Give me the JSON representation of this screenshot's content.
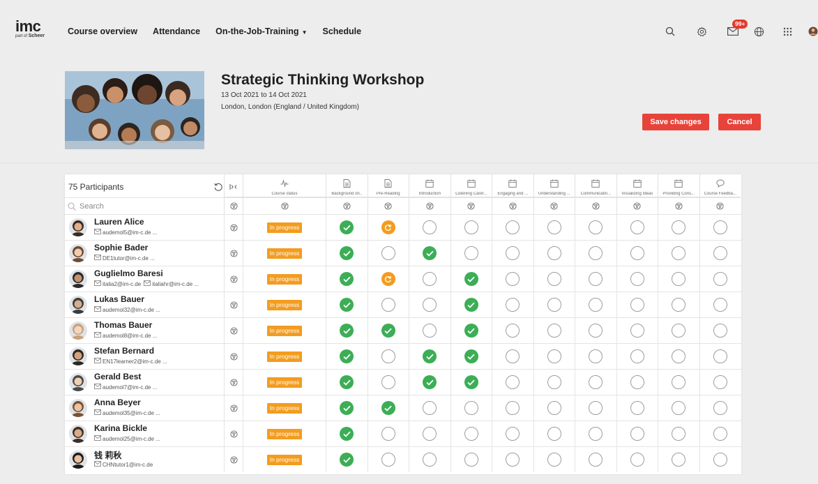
{
  "logo": {
    "text": "imc",
    "sub_prefix": "part of",
    "sub_brand": "Scheer"
  },
  "nav": {
    "items": [
      "Course overview",
      "Attendance",
      "On-the-Job-Training",
      "Schedule"
    ]
  },
  "topbar": {
    "icons": [
      "search-icon",
      "gear-icon",
      "mail-icon",
      "globe-icon",
      "apps-grid-icon",
      "user-avatar-icon"
    ],
    "notification_badge": "99+"
  },
  "course": {
    "title": "Strategic Thinking Workshop",
    "dates": "13 Oct 2021 to 14 Oct 2021",
    "location": "London, London (England / United Kingdom)"
  },
  "actions": {
    "save_label": "Save changes",
    "cancel_label": "Cancel"
  },
  "colors": {
    "accent": "#e8433a",
    "done": "#3cae56",
    "in_progress": "#f39c1f"
  },
  "grid": {
    "participant_count": "75 Participants",
    "search_placeholder": "Search",
    "status_column": {
      "label": "Course status",
      "icon": "activity-icon"
    },
    "columns": [
      {
        "label": "Background on..",
        "icon": "document-icon"
      },
      {
        "label": "Pre-Reading",
        "icon": "document-icon"
      },
      {
        "label": "Introduction",
        "icon": "calendar-icon"
      },
      {
        "label": "Listening Caref...",
        "icon": "calendar-icon"
      },
      {
        "label": "Engaging and ...",
        "icon": "calendar-icon"
      },
      {
        "label": "Understanding ...",
        "icon": "calendar-icon"
      },
      {
        "label": "Communicatin...",
        "icon": "calendar-icon"
      },
      {
        "label": "Visualizing Ideas",
        "icon": "calendar-icon"
      },
      {
        "label": "Providing Cons...",
        "icon": "calendar-icon"
      },
      {
        "label": "Course Feedba...",
        "icon": "chat-icon"
      }
    ],
    "participants": [
      {
        "name": "Lauren Alice",
        "email": "audemol5@im-c.de ...",
        "status": "In progress",
        "cells": [
          "done",
          "progress",
          "empty",
          "empty",
          "empty",
          "empty",
          "empty",
          "empty",
          "empty",
          "empty"
        ]
      },
      {
        "name": "Sophie Bader",
        "email": "DE1tutor@im-c.de ...",
        "status": "In progress",
        "cells": [
          "done",
          "empty",
          "done",
          "empty",
          "empty",
          "empty",
          "empty",
          "empty",
          "empty",
          "empty"
        ]
      },
      {
        "name": "Guglielmo Baresi",
        "email": "italia2@im-c.de",
        "email2": "italiahr@im-c.de ...",
        "status": "In progress",
        "cells": [
          "done",
          "progress",
          "empty",
          "done",
          "empty",
          "empty",
          "empty",
          "empty",
          "empty",
          "empty"
        ]
      },
      {
        "name": "Lukas Bauer",
        "email": "audemol32@im-c.de ...",
        "status": "In progress",
        "cells": [
          "done",
          "empty",
          "empty",
          "done",
          "empty",
          "empty",
          "empty",
          "empty",
          "empty",
          "empty"
        ]
      },
      {
        "name": "Thomas Bauer",
        "email": "audemol8@im-c.de ...",
        "status": "In progress",
        "cells": [
          "done",
          "done",
          "empty",
          "done",
          "empty",
          "empty",
          "empty",
          "empty",
          "empty",
          "empty"
        ]
      },
      {
        "name": "Stefan Bernard",
        "email": "EN17learner2@im-c.de ...",
        "status": "In progress",
        "cells": [
          "done",
          "empty",
          "done",
          "done",
          "empty",
          "empty",
          "empty",
          "empty",
          "empty",
          "empty"
        ]
      },
      {
        "name": "Gerald Best",
        "email": "audemol7@im-c.de ...",
        "status": "In progress",
        "cells": [
          "done",
          "empty",
          "done",
          "done",
          "empty",
          "empty",
          "empty",
          "empty",
          "empty",
          "empty"
        ]
      },
      {
        "name": "Anna Beyer",
        "email": "audemol35@im-c.de ...",
        "status": "In progress",
        "cells": [
          "done",
          "done",
          "empty",
          "empty",
          "empty",
          "empty",
          "empty",
          "empty",
          "empty",
          "empty"
        ]
      },
      {
        "name": "Karina Bickle",
        "email": "audemol25@im-c.de ...",
        "status": "In progress",
        "cells": [
          "done",
          "empty",
          "empty",
          "empty",
          "empty",
          "empty",
          "empty",
          "empty",
          "empty",
          "empty"
        ]
      },
      {
        "name": "钱 莉秋",
        "email": "CHNtutor1@im-c.de",
        "status": "In progress",
        "cells": [
          "done",
          "empty",
          "empty",
          "empty",
          "empty",
          "empty",
          "empty",
          "empty",
          "empty",
          "empty"
        ]
      }
    ]
  }
}
